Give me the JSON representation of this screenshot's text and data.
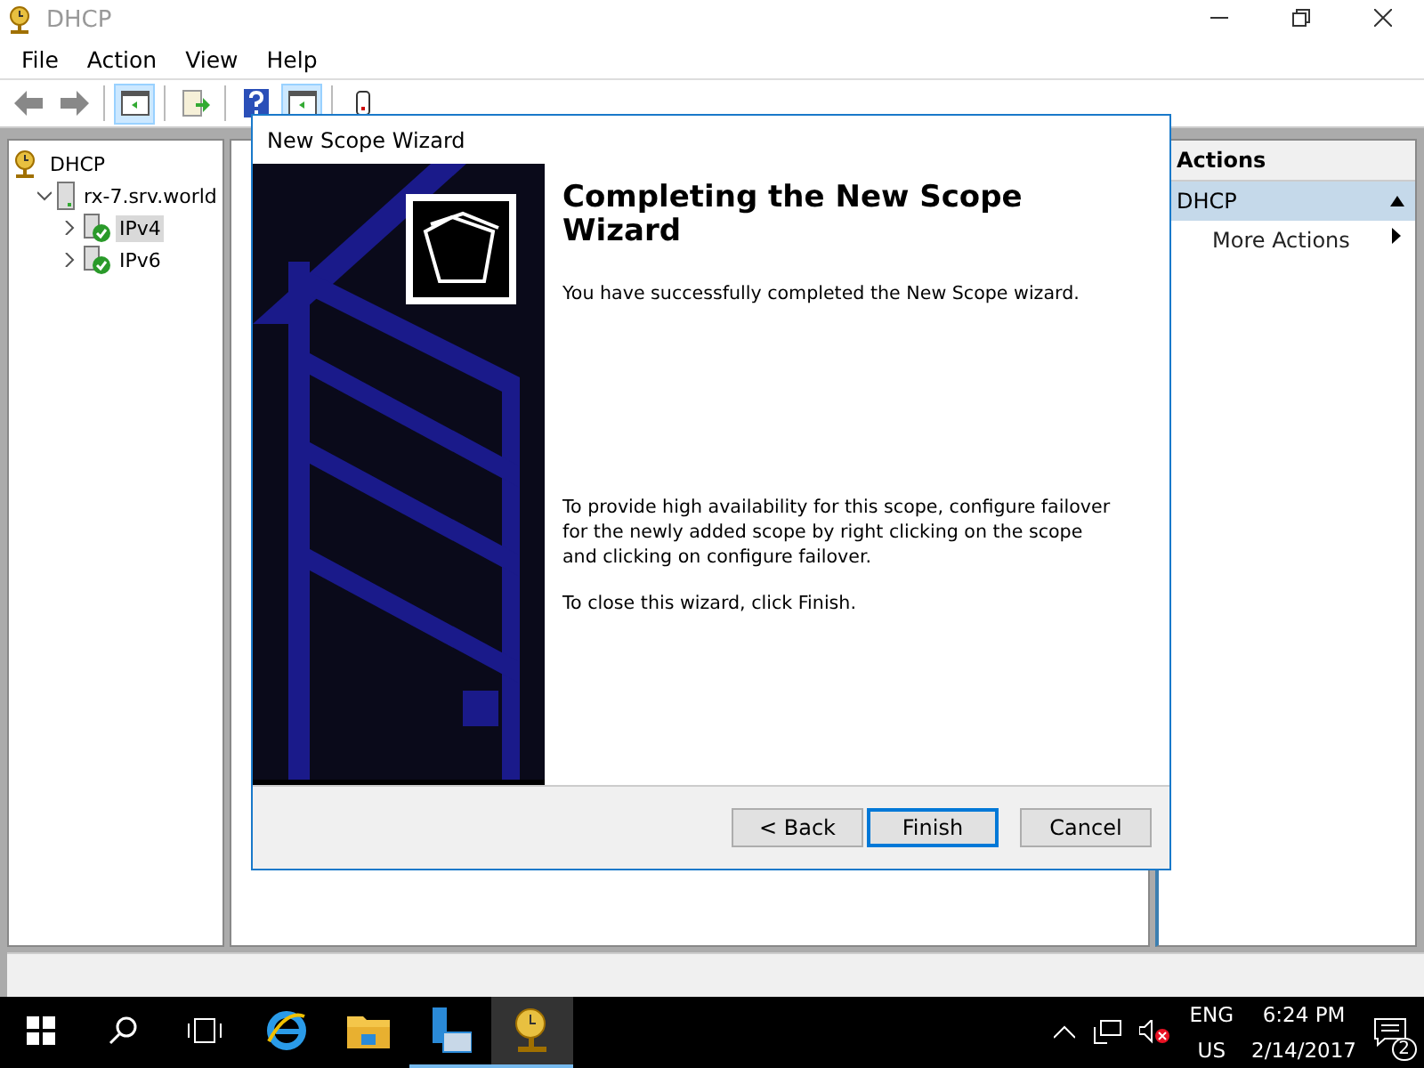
{
  "window": {
    "title": "DHCP"
  },
  "menu": [
    "File",
    "Action",
    "View",
    "Help"
  ],
  "toolbar": [
    {
      "kind": "back",
      "selected": false
    },
    {
      "kind": "forward",
      "selected": false
    },
    {
      "kind": "sep"
    },
    {
      "kind": "pane",
      "selected": true
    },
    {
      "kind": "sep"
    },
    {
      "kind": "export",
      "selected": false
    },
    {
      "kind": "sep"
    },
    {
      "kind": "help",
      "selected": false
    },
    {
      "kind": "pane2",
      "selected": true
    },
    {
      "kind": "sep"
    },
    {
      "kind": "server",
      "selected": false
    }
  ],
  "tree": [
    {
      "label": "DHCP",
      "kind": "dhcp",
      "selected": false,
      "children": [
        {
          "label": "rx-7.srv.world",
          "kind": "server",
          "expanded": true,
          "selected": false,
          "children": [
            {
              "label": "IPv4",
              "kind": "scope",
              "expanded": false,
              "selected": true
            },
            {
              "label": "IPv6",
              "kind": "scope",
              "expanded": false,
              "selected": false
            }
          ]
        }
      ]
    }
  ],
  "actions": {
    "title": "Actions",
    "section": "DHCP",
    "items": [
      "More Actions"
    ]
  },
  "dialog": {
    "title": "New Scope Wizard",
    "heading": "Completing the New Scope Wizard",
    "paragraphs": [
      "You have successfully completed the New Scope wizard.",
      "To provide high availability for this scope, configure failover for the newly added scope by right clicking on the scope and clicking on configure failover.",
      "To close this wizard, click Finish."
    ],
    "buttons": [
      {
        "label": "< Back",
        "default": false
      },
      {
        "label": "Finish",
        "default": true
      },
      {
        "label": "Cancel",
        "default": false
      }
    ]
  },
  "taskbar": {
    "apps": [
      {
        "kind": "ie",
        "running": false,
        "active": false
      },
      {
        "kind": "folder",
        "running": false,
        "active": false
      },
      {
        "kind": "server-manager",
        "running": true,
        "active": false
      },
      {
        "kind": "dhcp",
        "running": true,
        "active": true
      }
    ],
    "lang": [
      "ENG",
      "US"
    ],
    "time": "6:24 PM",
    "date": "2/14/2017",
    "notifications": "2"
  }
}
